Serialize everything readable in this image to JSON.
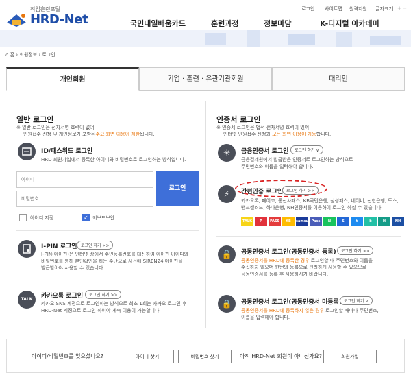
{
  "logo": {
    "tagline": "직업훈련포털",
    "name": "HRD-Net"
  },
  "util": [
    "로그인",
    "사이트맵",
    "원격지원",
    "글자크기"
  ],
  "util_size_controls": "+ −",
  "gnb": [
    "국민내일배움카드",
    "훈련과정",
    "정보마당",
    "K-디지털 아카데미"
  ],
  "breadcrumb": {
    "home": "홈",
    "level1": "회원정보",
    "current": "로그인"
  },
  "tabs": [
    {
      "label": "개인회원",
      "active": true
    },
    {
      "label": "기업 · 훈련 · 유관기관회원",
      "active": false
    },
    {
      "label": "대리인",
      "active": false
    }
  ],
  "general": {
    "title": "일반 로그인",
    "note_line1": "※ 일반 로그인은 전자서명 효력이 없어",
    "note_line2a": "민원접수 신청 및 개인정보가 포함된",
    "note_line2b": "주요 화면 이용이 제한",
    "note_line2c": "됩니다.",
    "id": {
      "title": "ID/패스워드 로그인",
      "desc": "HRD 회원가입에서 등록한 아이디와 비밀번호로 로그인하는 방식입니다.",
      "id_placeholder": "아이디",
      "pw_placeholder": "비밀번호",
      "login_label": "로그인",
      "save_id": "아이디 저장",
      "keyboard_security": "키보드보안"
    },
    "ipin": {
      "title": "I-PIN 로그인",
      "button": "로그인 하기  >>",
      "desc1": "I-PIN(아이핀)은 인터넷 상에서 주민등록번호를 대신하여 아이핀 아이디와",
      "desc2": "비밀번호를 통해 본인확인을 하는 수단으로 사전에 SIREN24 아이핀을",
      "desc3": "발급받아야 사용할 수 있습니다."
    },
    "kakao": {
      "title": "카카오톡 로그인",
      "button": "로그인 하기  >>",
      "desc1": "카카오 SNS 계정으로 로그인하는 방식으로 최초 1회는 카카오 로그인 후",
      "desc2": "HRD-Net 계정으로 로그인 하여야 계속 이용이 가능합니다."
    }
  },
  "cert": {
    "title": "인증서 로그인",
    "note_line1": "※ 인증서 로그인은 법적 전자서명 효력이 있어",
    "note_line2a": "인터넷 민원접수 신청과",
    "note_line2b": "모든 화면 이용이 가능",
    "note_line2c": "합니다.",
    "financial": {
      "title": "금융인증서 로그인",
      "button": "로그인 하기  ∨",
      "desc1": "금융결제원에서 발급받은 인증서로 로그인하는 방식으로",
      "desc2": "주민번호와 이름을 입력해야 합니다."
    },
    "simple": {
      "title": "간편인증 로그인",
      "button": "로그인 하기  >>",
      "desc1": "카카오톡, 페이코, 통신사패스, KB국민은행, 삼성패스, 네이버, 신한은행, 토스,",
      "desc2": "뱅크샐러드, 하나은행, NH인증서를 이용하여 로그인 하실 수 있습니다.",
      "providers": [
        {
          "label": "TALK",
          "color": "#f7d417"
        },
        {
          "label": "P",
          "color": "#e1323b"
        },
        {
          "label": "PASS",
          "color": "#e43c3c"
        },
        {
          "label": "KB",
          "color": "#ffbc00"
        },
        {
          "label": "samsung",
          "color": "#1b3b9a"
        },
        {
          "label": "Pass",
          "color": "#4a5db8"
        },
        {
          "label": "N",
          "color": "#19c35d"
        },
        {
          "label": "S",
          "color": "#2368d6"
        },
        {
          "label": "t",
          "color": "#1d8bf0"
        },
        {
          "label": "b",
          "color": "#22c0a6"
        },
        {
          "label": "H",
          "color": "#159c88"
        },
        {
          "label": "NH",
          "color": "#1c4fa3"
        }
      ]
    },
    "joint_reg": {
      "title": "공동인증서 로그인(공동인증서 등록)",
      "button": "로그인 하기  >>",
      "desc_orange": "공동인증서를 HRD에 등록한 경우",
      "desc1b": " 로그인할 때 주민번호와 이름을",
      "desc2": "수집하지 않으며 한번의 등록으로 편리하게 사용할 수 있으므로",
      "desc3": "공동인증서를 등록 후 사용하시기 바랍니다."
    },
    "joint_unreg": {
      "title": "공동인증서 로그인(공동인증서 미등록)",
      "button": "로그인 하기  ∨",
      "desc_orange": "공동인증서를 HRD에 등록하지 않은 경우",
      "desc1b": " 로그인할 때마다 주민번호,",
      "desc2": "이름을 입력해야 합니다."
    }
  },
  "bottom": {
    "forgot": "아이디/비밀번호를 잊으셨나요?",
    "find_id": "아이디 찾기",
    "find_pw": "비밀번호 찾기",
    "not_member": "아직 HRD-Net 회원이 아니신가요?",
    "join": "회원가입"
  },
  "colors": {
    "accent": "#3e6fd9",
    "highlight": "#e8760e",
    "annotation": "#d92323"
  }
}
